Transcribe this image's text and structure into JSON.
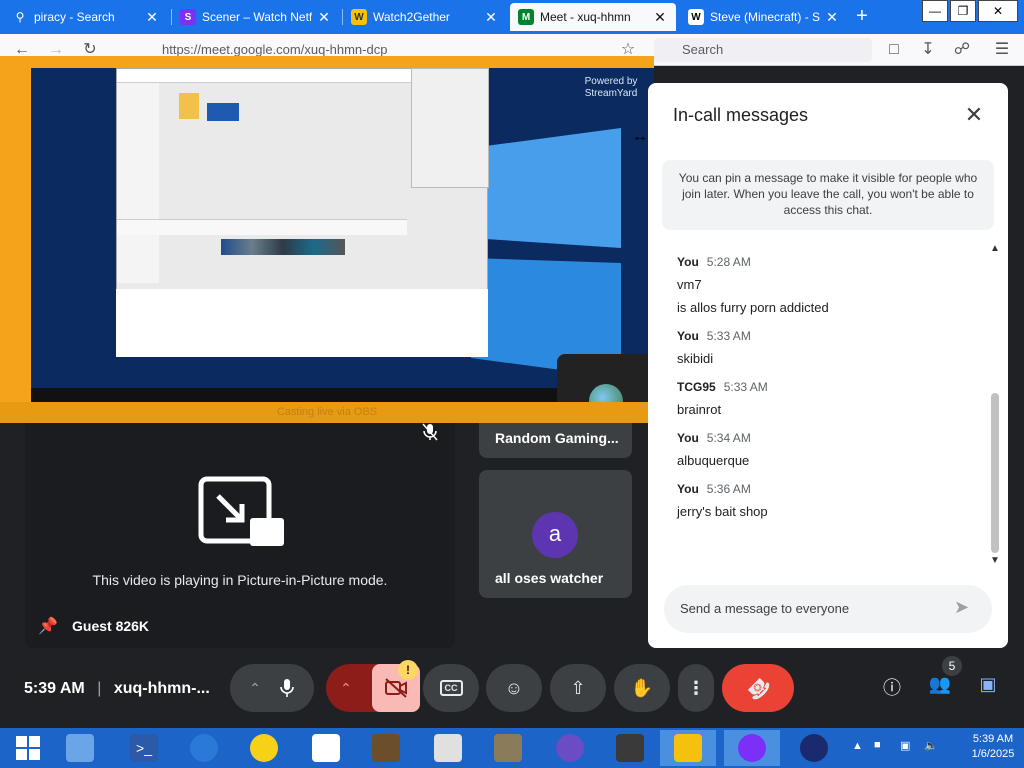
{
  "browser": {
    "tabs": [
      {
        "label": "piracy - Search",
        "icon": "search-icon"
      },
      {
        "label": "Scener – Watch Netfl",
        "icon": "scener-icon"
      },
      {
        "label": "Watch2Gether",
        "icon": "watch2gether-icon"
      },
      {
        "label": "Meet - xuq-hhmn",
        "icon": "meet-icon"
      },
      {
        "label": "Steve (Minecraft) - St",
        "icon": "wikipedia-icon"
      }
    ],
    "url": "https://meet.google.com/xuq-hhmn-dcp",
    "search_placeholder": "Search"
  },
  "video": {
    "watermark": "Powered by StreamYard",
    "caption": "Casting live via OBS"
  },
  "tiles": {
    "pip_message": "This video is playing in Picture-in-Picture mode.",
    "pinned_name": "Guest 826K",
    "participant_1": "Random Gaming...",
    "participant_2": "all oses watcher",
    "participant_2_initial": "a"
  },
  "chat": {
    "title": "In-call messages",
    "note": "You can pin a message to make it visible for people who join later. When you leave the call, you won't be able to access this chat.",
    "messages": [
      {
        "sender": "You",
        "time": "5:28 AM",
        "lines": [
          "vm7",
          "is allos furry porn addicted"
        ]
      },
      {
        "sender": "You",
        "time": "5:33 AM",
        "lines": [
          "skibidi"
        ]
      },
      {
        "sender": "TCG95",
        "time": "5:33 AM",
        "lines": [
          "brainrot"
        ]
      },
      {
        "sender": "You",
        "time": "5:34 AM",
        "lines": [
          "albuquerque"
        ]
      },
      {
        "sender": "You",
        "time": "5:36 AM",
        "lines": [
          "jerry's bait shop"
        ]
      }
    ],
    "composer_placeholder": "Send a message to everyone"
  },
  "bottom": {
    "time": "5:39 AM",
    "separator": "|",
    "meeting_code": "xuq-hhmn-...",
    "participant_count": "5",
    "warning_mark": "!"
  },
  "taskbar": {
    "time": "5:39 AM",
    "date": "1/6/2025"
  },
  "colors": {
    "meet_bg": "#202124",
    "tab_bar": "#1a73e8",
    "end_call": "#ea4335",
    "video_frame": "#f6a31c",
    "taskbar": "#1c64c8"
  }
}
